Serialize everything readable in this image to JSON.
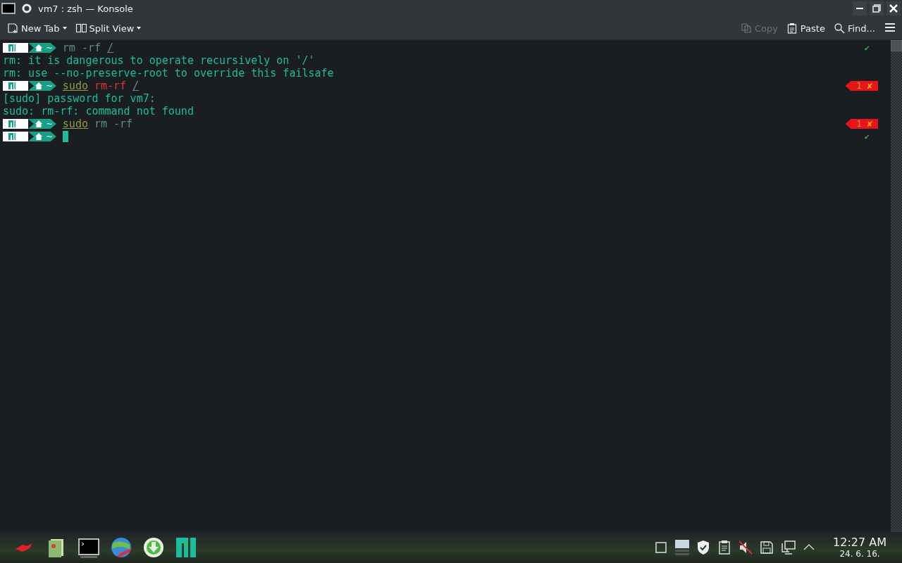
{
  "window": {
    "title": "vm7 : zsh — Konsole"
  },
  "toolbar": {
    "left": [
      {
        "label": "New Tab",
        "dropdown": true,
        "disabled": false
      },
      {
        "label": "Split View",
        "dropdown": true,
        "disabled": false
      }
    ],
    "right": [
      {
        "label": "Copy",
        "dropdown": false,
        "disabled": true
      },
      {
        "label": "Paste",
        "dropdown": false,
        "disabled": false
      },
      {
        "label": "Find...",
        "dropdown": false,
        "disabled": false
      }
    ]
  },
  "terminal": {
    "lines": [
      {
        "kind": "prompt",
        "dir": "~",
        "cursor": false,
        "command": [
          {
            "text": "rm -rf",
            "kind": "plain"
          },
          {
            "text": "/",
            "kind": "path"
          }
        ],
        "status": {
          "kind": "ok",
          "mark": "✔"
        }
      },
      {
        "kind": "output",
        "text": "rm: it is dangerous to operate recursively on '/'"
      },
      {
        "kind": "output",
        "text": "rm: use --no-preserve-root to override this failsafe"
      },
      {
        "kind": "prompt",
        "dir": "~",
        "cursor": false,
        "command": [
          {
            "text": "sudo",
            "kind": "valid"
          },
          {
            "text": "rm-rf",
            "kind": "invalid"
          },
          {
            "text": "/",
            "kind": "path"
          }
        ],
        "status": {
          "kind": "error",
          "code": "1",
          "mark": "✘"
        }
      },
      {
        "kind": "output",
        "text": "[sudo] password for vm7:"
      },
      {
        "kind": "output",
        "text": "sudo: rm-rf: command not found"
      },
      {
        "kind": "prompt",
        "dir": "~",
        "cursor": false,
        "command": [
          {
            "text": "sudo",
            "kind": "valid"
          },
          {
            "text": "rm -rf",
            "kind": "plain"
          }
        ],
        "status": {
          "kind": "error",
          "code": "1",
          "mark": "✘"
        }
      },
      {
        "kind": "prompt",
        "dir": "~",
        "cursor": true,
        "status": {
          "kind": "ok",
          "mark": "✔"
        }
      }
    ]
  },
  "taskbar": {
    "clock": {
      "time": "12:27 AM",
      "date": "24. 6. 16."
    }
  }
}
